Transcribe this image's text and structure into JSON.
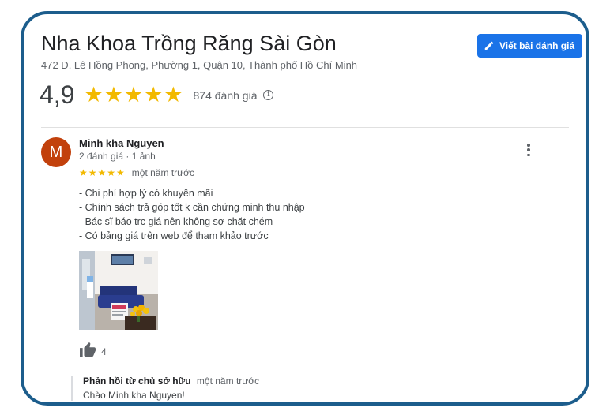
{
  "business": {
    "name": "Nha Khoa Trồng Răng Sài Gòn",
    "address": "472 Đ. Lê Hồng Phong, Phường 1, Quận 10, Thành phố Hồ Chí Minh"
  },
  "write_review_button": {
    "label": "Viết bài đánh giá",
    "icon": "pencil-icon"
  },
  "summary": {
    "rating": "4,9",
    "stars": "★★★★★",
    "review_count": "874 đánh giá",
    "info_icon": "i"
  },
  "review": {
    "avatar_letter": "M",
    "avatar_color": "#c2410c",
    "author": "Minh kha Nguyen",
    "author_meta": "2 đánh giá · 1 ảnh",
    "stars": "★★★★★",
    "time": "một năm trước",
    "lines": [
      "- Chi phí hợp lý có khuyến mãi",
      "- Chính sách trả góp tốt k cần chứng minh thu nhập",
      "- Bác sĩ báo trc giá nên không sợ chặt chém",
      "- Có bảng giá trên web để tham khảo trước"
    ],
    "photo_icon": "clinic-waiting-room-photo",
    "like_count": "4",
    "like_icon": "thumbs-up-icon"
  },
  "owner_reply": {
    "label": "Phản hồi từ chủ sở hữu",
    "time": "một năm trước",
    "text": "Chào Minh kha Nguyen!"
  },
  "colors": {
    "frame_border": "#1c5d8c",
    "button_blue": "#1a73e8",
    "star_yellow": "#f2b900"
  }
}
